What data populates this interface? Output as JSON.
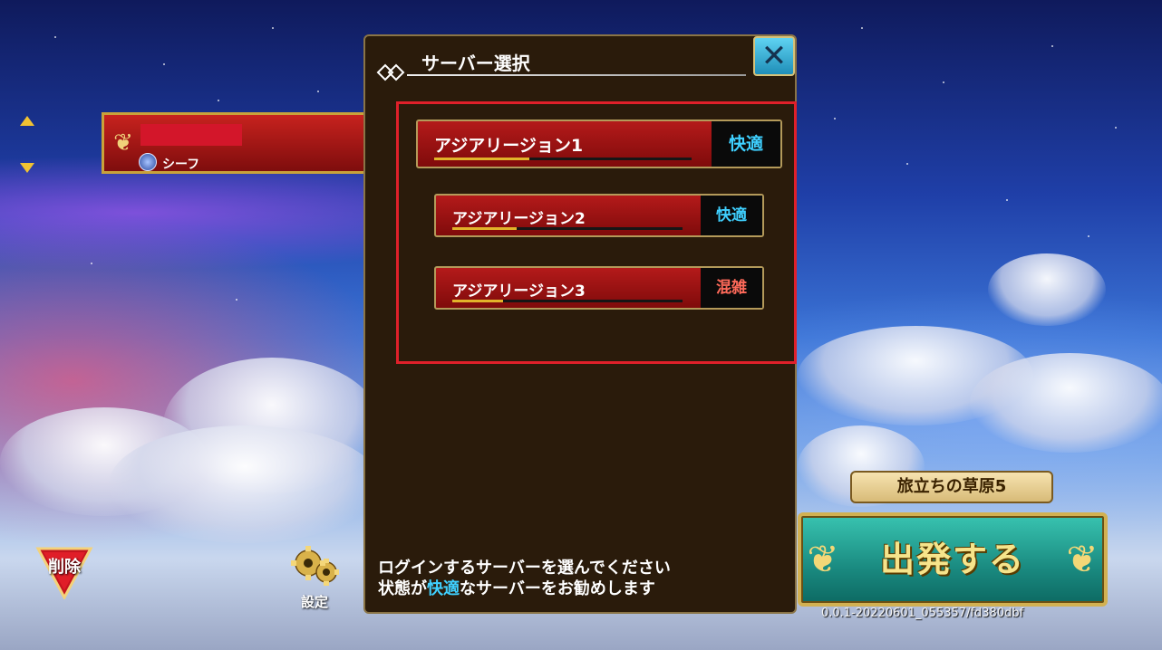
{
  "character": {
    "class_label": "シーフ"
  },
  "left_controls": {
    "delete_label": "削除",
    "settings_label": "設定"
  },
  "right_controls": {
    "area_name": "旅立ちの草原5",
    "depart_label": "出発する",
    "version": "0.0.1-20220601_055357/fd380dbf"
  },
  "dialog": {
    "title": "サーバー選択",
    "close_symbol": "✕",
    "servers": [
      {
        "name": "アジアリージョン1",
        "status": "快適",
        "load": 0.37
      },
      {
        "name": "アジアリージョン2",
        "status": "快適",
        "load": 0.28
      },
      {
        "name": "アジアリージョン3",
        "status": "混雑",
        "load": 0.22
      }
    ],
    "message_line1": "ログインするサーバーを選んでください",
    "message_line2_prefix": "状態が",
    "message_line2_accent": "快適",
    "message_line2_suffix": "なサーバーをお勧めします"
  },
  "colors": {
    "status_comfortable": "#3fd0ff",
    "status_crowded": "#ff6a5a",
    "highlight_border": "#e0202a"
  },
  "icons": [
    "up-arrow-icon",
    "down-arrow-icon",
    "shield-icon",
    "gear-icon",
    "close-icon",
    "title-diamond-icon"
  ]
}
